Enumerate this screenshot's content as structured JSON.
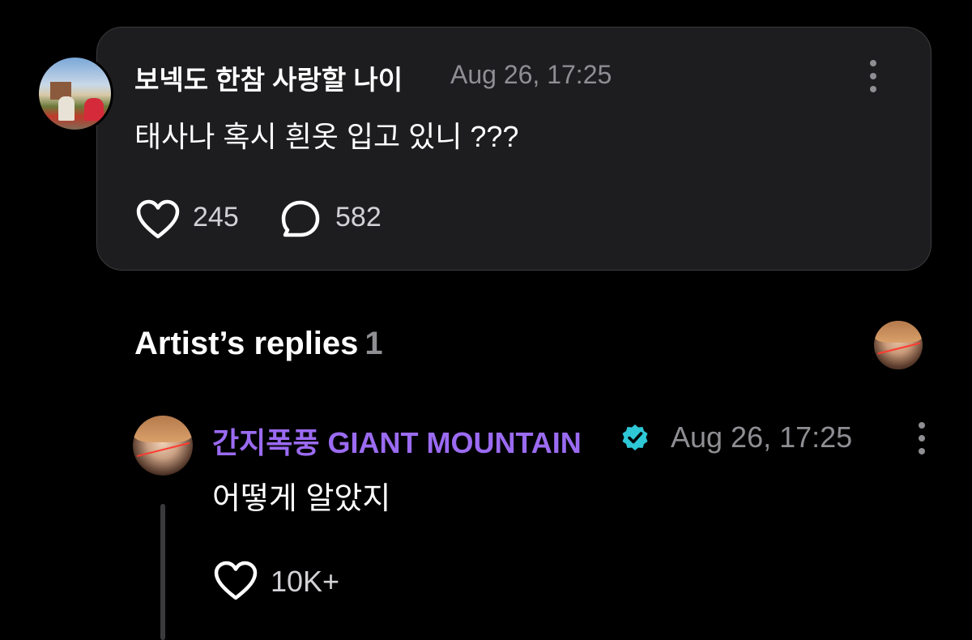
{
  "post": {
    "author": "보넥도 한참 사랑할 나이",
    "timestamp": "Aug 26, 17:25",
    "text": "태사나 혹시 흰옷 입고 있니 ???",
    "like_count": "245",
    "comment_count": "582",
    "icons": {
      "like": "heart-icon",
      "comment": "comment-bubble-icon",
      "more": "more-vertical-icon"
    }
  },
  "replies_section": {
    "title": "Artist’s replies",
    "count": "1"
  },
  "reply": {
    "author": "간지폭풍 GIANT MOUNTAIN",
    "timestamp": "Aug 26, 17:25",
    "text": "어떻게 알았지",
    "like_count": "10K+",
    "verified": true
  },
  "colors": {
    "background": "#000000",
    "card": "#1d1d1f",
    "artist_name": "#9b6bf2",
    "verified_badge": "#2ec7d6",
    "muted_text": "#8e8e93"
  }
}
